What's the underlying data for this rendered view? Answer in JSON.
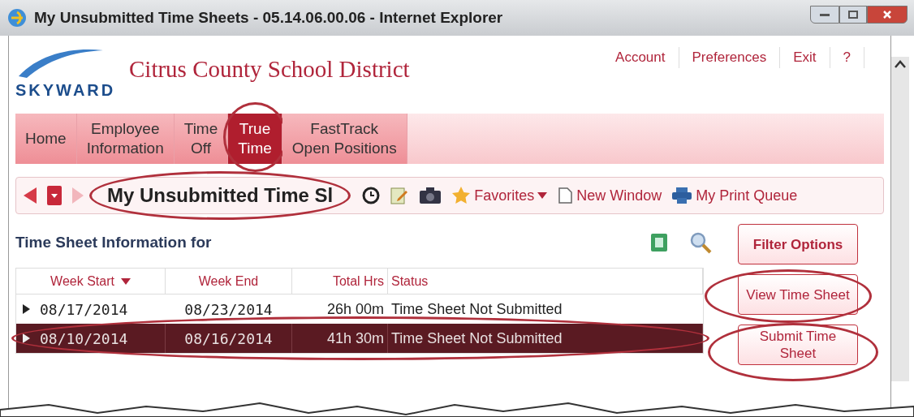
{
  "window": {
    "title": "My Unsubmitted Time Sheets - 05.14.06.00.06 - Internet Explorer"
  },
  "header": {
    "logo": "SKYWARD",
    "district": "Citrus County School District",
    "links": [
      "Account",
      "Preferences",
      "Exit",
      "?"
    ]
  },
  "nav_tabs": [
    {
      "lines": [
        "Home"
      ],
      "selected": false
    },
    {
      "lines": [
        "Employee",
        "Information"
      ],
      "selected": false
    },
    {
      "lines": [
        "Time",
        "Off"
      ],
      "selected": false
    },
    {
      "lines": [
        "True",
        "Time"
      ],
      "selected": true
    },
    {
      "lines": [
        "FastTrack",
        "Open Positions"
      ],
      "selected": false
    }
  ],
  "toolbar": {
    "page_title": "My Unsubmitted Time Sl",
    "items": [
      {
        "kind": "menu",
        "label": "Favorites"
      },
      {
        "kind": "link",
        "label": "New Window"
      },
      {
        "kind": "print",
        "label": "My Print Queue"
      }
    ]
  },
  "section": {
    "title": "Time Sheet Information for"
  },
  "table": {
    "columns": [
      {
        "label": "Week Start",
        "sorted": true
      },
      {
        "label": "Week End",
        "sorted": false
      },
      {
        "label": "Total Hrs",
        "sorted": false
      },
      {
        "label": "Status",
        "sorted": false
      }
    ],
    "rows": [
      {
        "cells": [
          "08/17/2014",
          "08/23/2014",
          "26h 00m",
          "Time Sheet Not Submitted"
        ],
        "selected": false
      },
      {
        "cells": [
          "08/10/2014",
          "08/16/2014",
          "41h 30m",
          "Time Sheet Not Submitted"
        ],
        "selected": true
      }
    ]
  },
  "buttons": [
    "Filter Options",
    "View Time Sheet",
    "Submit Time Sheet"
  ]
}
